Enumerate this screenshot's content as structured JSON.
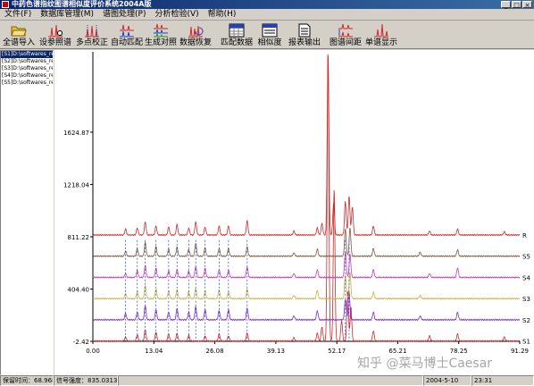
{
  "window": {
    "title": "中药色谱指纹图谱相似度评价系统2004A版",
    "buttons": {
      "minimize": "_",
      "maximize": "□",
      "close": "×"
    }
  },
  "menu": [
    {
      "label": "文件(F)"
    },
    {
      "label": "数据库管理(M)"
    },
    {
      "label": "谱图处理(P)"
    },
    {
      "label": "分析检验(V)"
    },
    {
      "label": "帮助(H)"
    }
  ],
  "toolbar": [
    {
      "label": "全谱导入",
      "icon": "folder-open-icon"
    },
    {
      "label": "设参照谱",
      "icon": "reference-spectrum-icon"
    },
    {
      "label": "多点校正",
      "icon": "multipoint-correction-icon"
    },
    {
      "label": "自动匹配",
      "icon": "auto-match-icon"
    },
    {
      "label": "生成对照",
      "icon": "generate-reference-icon"
    },
    {
      "label": "数据恢复",
      "icon": "data-restore-icon"
    },
    {
      "label": "匹配数据",
      "icon": "match-data-icon"
    },
    {
      "label": "相似度",
      "icon": "similarity-icon"
    },
    {
      "label": "报表输出",
      "icon": "report-output-icon"
    },
    {
      "label": "图谱间距",
      "icon": "spectrum-spacing-icon"
    },
    {
      "label": "单谱显示",
      "icon": "single-spectrum-icon"
    }
  ],
  "files": [
    {
      "label": "[S1]D:\\softwares_re"
    },
    {
      "label": "[S2]D:\\softwares_re"
    },
    {
      "label": "[S3]D:\\softwares_re"
    },
    {
      "label": "[S4]D:\\softwares_re"
    },
    {
      "label": "[S5]D:\\softwares_re"
    }
  ],
  "chart_data": {
    "type": "line",
    "title": "",
    "xlabel": "",
    "ylabel": "",
    "xlim": [
      0,
      91.29
    ],
    "ylim": [
      -2.42,
      2250
    ],
    "x_ticks": [
      "0.00",
      "13.04",
      "26.08",
      "39.13",
      "52.17",
      "65.21",
      "78.25",
      "91.29"
    ],
    "y_ticks": [
      "-2.42",
      "404.40",
      "811.22",
      "1218.04",
      "1624.87"
    ],
    "grid": false,
    "series": [
      {
        "name": "S1",
        "color": "#d02828",
        "offset": 0,
        "peaks": [
          [
            7.0,
            30
          ],
          [
            9.5,
            50
          ],
          [
            11.2,
            90
          ],
          [
            13.5,
            70
          ],
          [
            16.2,
            55
          ],
          [
            18.0,
            60
          ],
          [
            20.5,
            45
          ],
          [
            24.0,
            40
          ],
          [
            27.0,
            55
          ],
          [
            29.0,
            40
          ],
          [
            33.0,
            60
          ],
          [
            43.0,
            25
          ],
          [
            48.0,
            60
          ],
          [
            49.0,
            110
          ],
          [
            50.3,
            2250
          ],
          [
            51.6,
            1180
          ],
          [
            53.2,
            160
          ],
          [
            54.5,
            390
          ],
          [
            55.2,
            260
          ],
          [
            60.0,
            80
          ],
          [
            72.0,
            40
          ],
          [
            78.0,
            55
          ],
          [
            88.0,
            30
          ]
        ]
      },
      {
        "name": "S2",
        "color": "#7a2ad0",
        "offset": 165,
        "peaks": [
          [
            7.0,
            50
          ],
          [
            9.5,
            60
          ],
          [
            11.2,
            110
          ],
          [
            13.5,
            80
          ],
          [
            16.2,
            60
          ],
          [
            18.0,
            90
          ],
          [
            20.5,
            60
          ],
          [
            22.0,
            100
          ],
          [
            24.0,
            80
          ],
          [
            27.0,
            70
          ],
          [
            29.0,
            80
          ],
          [
            33.0,
            90
          ],
          [
            43.0,
            30
          ],
          [
            48.0,
            70
          ],
          [
            54.0,
            160
          ],
          [
            54.8,
            220
          ],
          [
            60.0,
            60
          ],
          [
            70.0,
            30
          ],
          [
            78.0,
            60
          ]
        ]
      },
      {
        "name": "S3",
        "color": "#c8b43c",
        "offset": 330,
        "peaks": [
          [
            7.0,
            40
          ],
          [
            9.5,
            55
          ],
          [
            11.2,
            100
          ],
          [
            13.5,
            75
          ],
          [
            16.2,
            60
          ],
          [
            18.0,
            70
          ],
          [
            20.5,
            55
          ],
          [
            22.0,
            80
          ],
          [
            24.0,
            60
          ],
          [
            27.0,
            70
          ],
          [
            29.0,
            50
          ],
          [
            33.0,
            75
          ],
          [
            43.0,
            25
          ],
          [
            48.0,
            65
          ],
          [
            54.0,
            180
          ],
          [
            55.0,
            200
          ],
          [
            60.0,
            50
          ],
          [
            70.0,
            25
          ]
        ]
      },
      {
        "name": "S4",
        "color": "#c83cb4",
        "offset": 495,
        "peaks": [
          [
            7.0,
            30
          ],
          [
            9.5,
            55
          ],
          [
            11.2,
            90
          ],
          [
            13.5,
            70
          ],
          [
            16.2,
            50
          ],
          [
            18.0,
            60
          ],
          [
            20.5,
            50
          ],
          [
            22.0,
            85
          ],
          [
            24.0,
            70
          ],
          [
            27.0,
            60
          ],
          [
            29.0,
            55
          ],
          [
            33.0,
            80
          ],
          [
            43.0,
            30
          ],
          [
            48.0,
            60
          ],
          [
            54.0,
            200
          ],
          [
            55.0,
            180
          ],
          [
            60.0,
            60
          ],
          [
            72.0,
            30
          ],
          [
            78.0,
            75
          ]
        ]
      },
      {
        "name": "S5",
        "color": "#7a5c40",
        "offset": 660,
        "peaks": [
          [
            7.0,
            40
          ],
          [
            9.5,
            60
          ],
          [
            11.2,
            105
          ],
          [
            13.5,
            75
          ],
          [
            16.2,
            55
          ],
          [
            18.0,
            70
          ],
          [
            20.5,
            55
          ],
          [
            22.0,
            100
          ],
          [
            24.0,
            65
          ],
          [
            27.0,
            60
          ],
          [
            29.0,
            60
          ],
          [
            33.0,
            70
          ],
          [
            43.0,
            25
          ],
          [
            48.0,
            55
          ],
          [
            54.0,
            210
          ],
          [
            55.0,
            220
          ],
          [
            60.0,
            60
          ],
          [
            70.0,
            30
          ],
          [
            78.0,
            50
          ]
        ]
      },
      {
        "name": "R",
        "color": "#d02828",
        "offset": 825,
        "peaks": [
          [
            7.0,
            45
          ],
          [
            9.5,
            55
          ],
          [
            11.2,
            100
          ],
          [
            13.5,
            70
          ],
          [
            16.2,
            60
          ],
          [
            18.0,
            80
          ],
          [
            20.5,
            55
          ],
          [
            22.0,
            100
          ],
          [
            24.0,
            60
          ],
          [
            27.0,
            70
          ],
          [
            29.0,
            70
          ],
          [
            33.0,
            110
          ],
          [
            43.0,
            30
          ],
          [
            48.0,
            55
          ],
          [
            49.0,
            90
          ],
          [
            50.3,
            1400
          ],
          [
            51.5,
            250
          ],
          [
            54.0,
            260
          ],
          [
            54.8,
            300
          ],
          [
            55.5,
            220
          ],
          [
            60.0,
            70
          ],
          [
            72.0,
            30
          ],
          [
            78.0,
            45
          ],
          [
            88.0,
            25
          ]
        ]
      }
    ],
    "marker_retention_times": [
      7.0,
      9.5,
      11.2,
      13.5,
      16.2,
      18.0,
      20.5,
      22.0,
      24.0,
      27.0,
      29.0,
      33.0,
      54.0,
      54.8
    ]
  },
  "status": {
    "retention": "保留时间：68.9683",
    "intensity": "信号强度：835.0313",
    "date": "2004-5-10",
    "time": "23:31"
  },
  "watermark": "知乎 @菜马博士Caesar"
}
